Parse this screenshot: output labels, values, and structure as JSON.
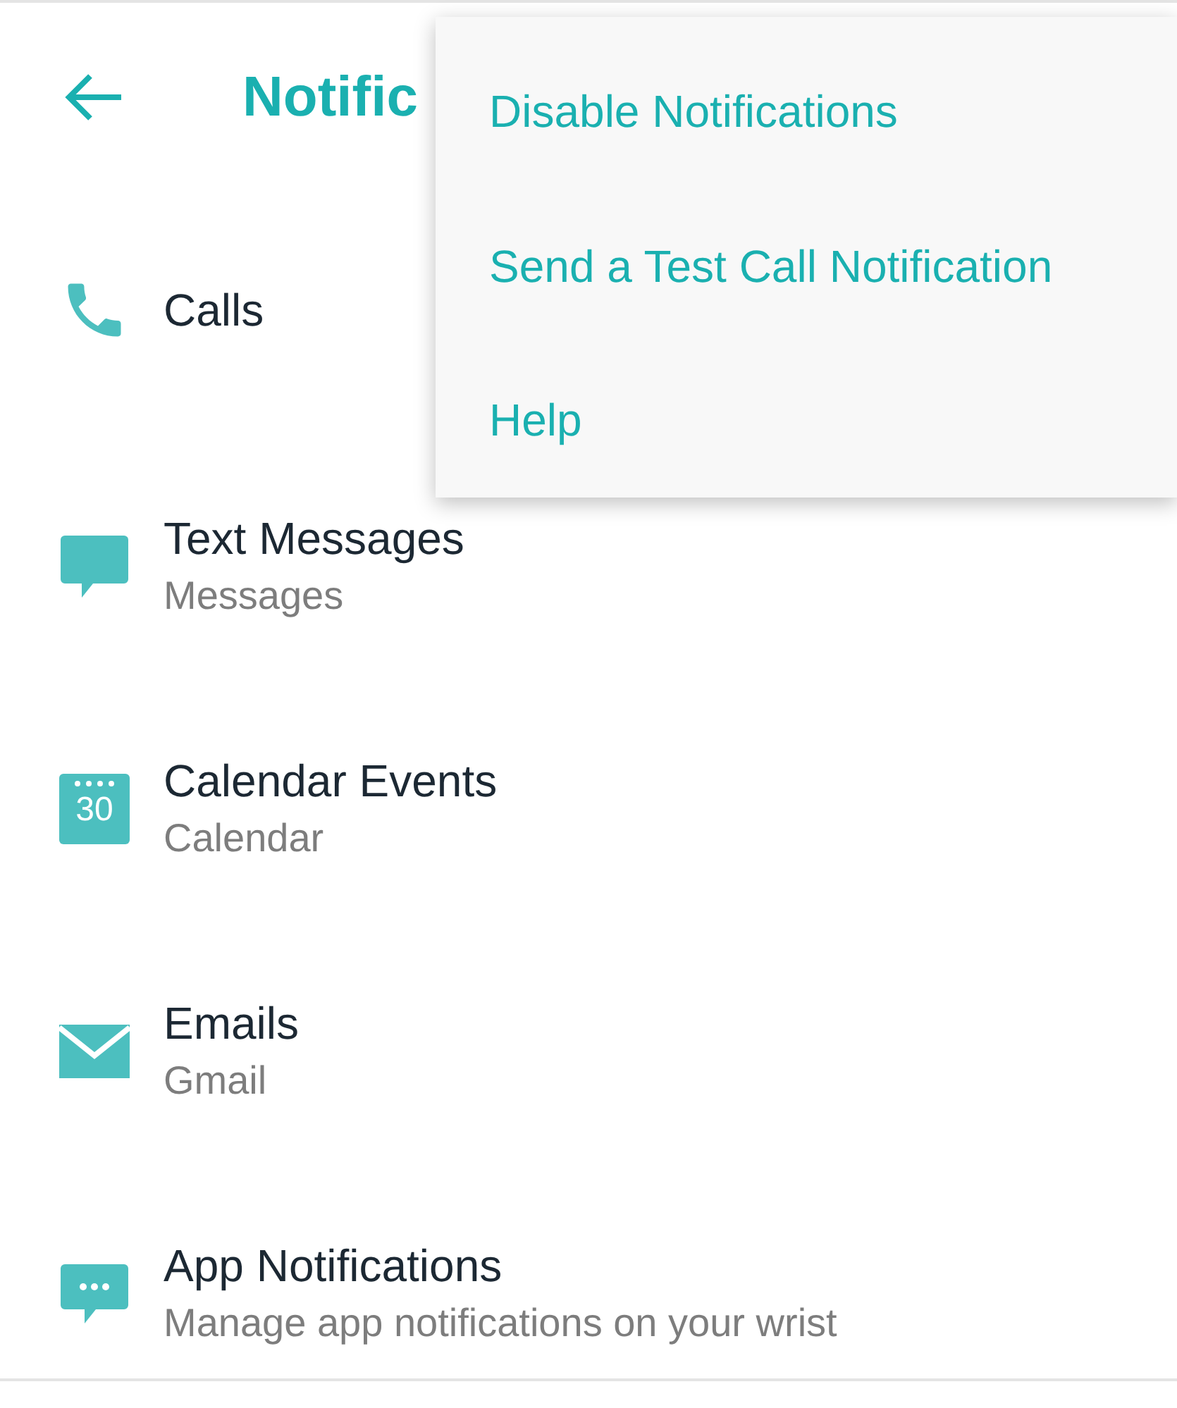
{
  "header": {
    "title": "Notific"
  },
  "menu": {
    "items": [
      {
        "label": "Disable Notifications"
      },
      {
        "label": "Send a Test Call Notification"
      },
      {
        "label": "Help"
      }
    ]
  },
  "items": [
    {
      "kind": "calls",
      "title": "Calls"
    },
    {
      "kind": "text",
      "title": "Text Messages",
      "subtitle": "Messages"
    },
    {
      "kind": "calendar",
      "title": "Calendar Events",
      "subtitle": "Calendar",
      "icon_text": "30"
    },
    {
      "kind": "email",
      "title": "Emails",
      "subtitle": "Gmail"
    },
    {
      "kind": "apps",
      "title": "App Notifications",
      "subtitle": "Manage app notifications on your wrist"
    }
  ]
}
